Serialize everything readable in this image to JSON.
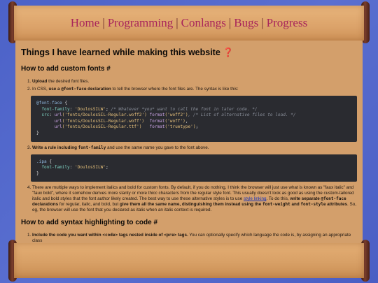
{
  "nav": {
    "items": [
      "Home",
      "Programming",
      "Conlangs",
      "Bugs",
      "Progress"
    ],
    "separator": "|"
  },
  "page": {
    "title": "Things I have learned while making this website ❓",
    "section1_title": "How to add custom fonts #",
    "step1": "Upload the desired font files.",
    "step1_bold": "Upload",
    "step1_rest": " the desired font files.",
    "step2_a": "In CSS, ",
    "step2_b": "use a ",
    "step2_code": "@font-face",
    "step2_c": " declaration",
    "step2_d": " to tell the browser where the font files are. The syntax is like this:",
    "code1": {
      "l1_sel": "@font-face",
      "l1_brace": " {",
      "l2_prop": "font-family",
      "l2_colon": ": ",
      "l2_str": "'DoulosSILW'",
      "l2_semi": "; ",
      "l2_com": "/* Whatever *you* want to call the font in later code. */",
      "l3_prop": "src",
      "l3_colon": ": ",
      "l3_fn1": "url",
      "l3_str1": "('fonts/DoulosSIL-Regular.woff2')",
      "l3_fn2": "format",
      "l3_str2": "('woff2')",
      "l3_com": ", /* List of alternative files to load. */",
      "l4_fn1": "url",
      "l4_str1": "('fonts/DoulosSIL-Regular.woff')",
      "l4_fn2": "format",
      "l4_str2": "('woff')",
      "l4_end": ",",
      "l5_fn1": "url",
      "l5_str1": "('fonts/DoulosSIL-Regular.ttf')",
      "l5_fn2": "format",
      "l5_str2": "('truetype')",
      "l5_end": ";",
      "l6_brace": "}"
    },
    "step3_a": "Write a rule including ",
    "step3_code": "font-family",
    "step3_b": " and use the same name you gave to the font above.",
    "code2": {
      "l1_sel": ".ipa",
      "l1_brace": " {",
      "l2_prop": "font-family",
      "l2_colon": ": ",
      "l2_str": "'DoulosSILW'",
      "l2_semi": ";",
      "l3_brace": "}"
    },
    "step4_a": "There are multiple ways to implement italics and bold for custom fonts. By default, if you do nothing, I think the browser will just use what is known as \"faux italic\" and \"faux bold\", where it somehow derives more slanty or more thicc characters from the regular style font. This usually doesn't look as good as using the custom-tailored italic and bold styles that the font author likely created. The best way to use these alternative styles is to use ",
    "step4_link": "style linking",
    "step4_b": ". To do this, ",
    "step4_bold1": "write separate ",
    "step4_code1": "@font-face",
    "step4_bold2": " declarations",
    "step4_c": " for regular, italic, and bold, but ",
    "step4_bold3": "give them all the same name, distinguishing them instead using the ",
    "step4_code2": "font-weight",
    "step4_bold4": " and ",
    "step4_code3": "font-style",
    "step4_bold5": " attributes",
    "step4_d": ". So, eg, the browser will use the font that you declared as italic when an italic context is required.",
    "section2_title": "How to add syntax highlighting to code #",
    "s2_step1_a": "Include the code you want within ",
    "s2_step1_code1": "<code>",
    "s2_step1_b": " tags nested inside of ",
    "s2_step1_code2": "<pre>",
    "s2_step1_c": " tags.",
    "s2_step1_d": " You can optionally specify which language the code is, by assigning an appropriate class"
  }
}
